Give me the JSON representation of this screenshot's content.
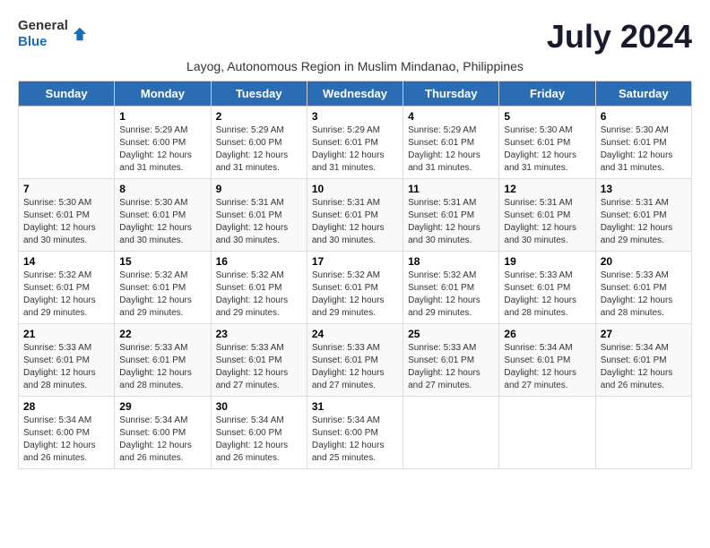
{
  "header": {
    "logo_general": "General",
    "logo_blue": "Blue",
    "month_title": "July 2024",
    "subtitle": "Layog, Autonomous Region in Muslim Mindanao, Philippines"
  },
  "days_of_week": [
    "Sunday",
    "Monday",
    "Tuesday",
    "Wednesday",
    "Thursday",
    "Friday",
    "Saturday"
  ],
  "weeks": [
    [
      {
        "day": "",
        "info": ""
      },
      {
        "day": "1",
        "info": "Sunrise: 5:29 AM\nSunset: 6:00 PM\nDaylight: 12 hours\nand 31 minutes."
      },
      {
        "day": "2",
        "info": "Sunrise: 5:29 AM\nSunset: 6:00 PM\nDaylight: 12 hours\nand 31 minutes."
      },
      {
        "day": "3",
        "info": "Sunrise: 5:29 AM\nSunset: 6:01 PM\nDaylight: 12 hours\nand 31 minutes."
      },
      {
        "day": "4",
        "info": "Sunrise: 5:29 AM\nSunset: 6:01 PM\nDaylight: 12 hours\nand 31 minutes."
      },
      {
        "day": "5",
        "info": "Sunrise: 5:30 AM\nSunset: 6:01 PM\nDaylight: 12 hours\nand 31 minutes."
      },
      {
        "day": "6",
        "info": "Sunrise: 5:30 AM\nSunset: 6:01 PM\nDaylight: 12 hours\nand 31 minutes."
      }
    ],
    [
      {
        "day": "7",
        "info": "Sunrise: 5:30 AM\nSunset: 6:01 PM\nDaylight: 12 hours\nand 30 minutes."
      },
      {
        "day": "8",
        "info": "Sunrise: 5:30 AM\nSunset: 6:01 PM\nDaylight: 12 hours\nand 30 minutes."
      },
      {
        "day": "9",
        "info": "Sunrise: 5:31 AM\nSunset: 6:01 PM\nDaylight: 12 hours\nand 30 minutes."
      },
      {
        "day": "10",
        "info": "Sunrise: 5:31 AM\nSunset: 6:01 PM\nDaylight: 12 hours\nand 30 minutes."
      },
      {
        "day": "11",
        "info": "Sunrise: 5:31 AM\nSunset: 6:01 PM\nDaylight: 12 hours\nand 30 minutes."
      },
      {
        "day": "12",
        "info": "Sunrise: 5:31 AM\nSunset: 6:01 PM\nDaylight: 12 hours\nand 30 minutes."
      },
      {
        "day": "13",
        "info": "Sunrise: 5:31 AM\nSunset: 6:01 PM\nDaylight: 12 hours\nand 29 minutes."
      }
    ],
    [
      {
        "day": "14",
        "info": "Sunrise: 5:32 AM\nSunset: 6:01 PM\nDaylight: 12 hours\nand 29 minutes."
      },
      {
        "day": "15",
        "info": "Sunrise: 5:32 AM\nSunset: 6:01 PM\nDaylight: 12 hours\nand 29 minutes."
      },
      {
        "day": "16",
        "info": "Sunrise: 5:32 AM\nSunset: 6:01 PM\nDaylight: 12 hours\nand 29 minutes."
      },
      {
        "day": "17",
        "info": "Sunrise: 5:32 AM\nSunset: 6:01 PM\nDaylight: 12 hours\nand 29 minutes."
      },
      {
        "day": "18",
        "info": "Sunrise: 5:32 AM\nSunset: 6:01 PM\nDaylight: 12 hours\nand 29 minutes."
      },
      {
        "day": "19",
        "info": "Sunrise: 5:33 AM\nSunset: 6:01 PM\nDaylight: 12 hours\nand 28 minutes."
      },
      {
        "day": "20",
        "info": "Sunrise: 5:33 AM\nSunset: 6:01 PM\nDaylight: 12 hours\nand 28 minutes."
      }
    ],
    [
      {
        "day": "21",
        "info": "Sunrise: 5:33 AM\nSunset: 6:01 PM\nDaylight: 12 hours\nand 28 minutes."
      },
      {
        "day": "22",
        "info": "Sunrise: 5:33 AM\nSunset: 6:01 PM\nDaylight: 12 hours\nand 28 minutes."
      },
      {
        "day": "23",
        "info": "Sunrise: 5:33 AM\nSunset: 6:01 PM\nDaylight: 12 hours\nand 27 minutes."
      },
      {
        "day": "24",
        "info": "Sunrise: 5:33 AM\nSunset: 6:01 PM\nDaylight: 12 hours\nand 27 minutes."
      },
      {
        "day": "25",
        "info": "Sunrise: 5:33 AM\nSunset: 6:01 PM\nDaylight: 12 hours\nand 27 minutes."
      },
      {
        "day": "26",
        "info": "Sunrise: 5:34 AM\nSunset: 6:01 PM\nDaylight: 12 hours\nand 27 minutes."
      },
      {
        "day": "27",
        "info": "Sunrise: 5:34 AM\nSunset: 6:01 PM\nDaylight: 12 hours\nand 26 minutes."
      }
    ],
    [
      {
        "day": "28",
        "info": "Sunrise: 5:34 AM\nSunset: 6:00 PM\nDaylight: 12 hours\nand 26 minutes."
      },
      {
        "day": "29",
        "info": "Sunrise: 5:34 AM\nSunset: 6:00 PM\nDaylight: 12 hours\nand 26 minutes."
      },
      {
        "day": "30",
        "info": "Sunrise: 5:34 AM\nSunset: 6:00 PM\nDaylight: 12 hours\nand 26 minutes."
      },
      {
        "day": "31",
        "info": "Sunrise: 5:34 AM\nSunset: 6:00 PM\nDaylight: 12 hours\nand 25 minutes."
      },
      {
        "day": "",
        "info": ""
      },
      {
        "day": "",
        "info": ""
      },
      {
        "day": "",
        "info": ""
      }
    ]
  ]
}
